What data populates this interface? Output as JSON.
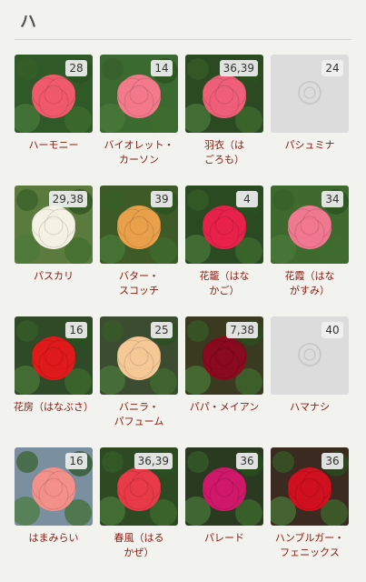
{
  "section": {
    "title": "ハ"
  },
  "items": [
    {
      "name": "ハーモニー",
      "badge": "28",
      "bg": "#2f5a28",
      "rose": "#f05a6a",
      "placeholder": false
    },
    {
      "name": "バイオレット・\nカーソン",
      "badge": "14",
      "bg": "#3b6a30",
      "rose": "#f37a8a",
      "placeholder": false
    },
    {
      "name": "羽衣（は\nごろも）",
      "badge": "36,39",
      "bg": "#2c4a22",
      "rose": "#ef5f78",
      "placeholder": false
    },
    {
      "name": "パシュミナ",
      "badge": "24",
      "bg": "#dcdcdc",
      "rose": "#c9c9c9",
      "placeholder": true
    },
    {
      "name": "パスカリ",
      "badge": "29,38",
      "bg": "#5b7a3e",
      "rose": "#f5f1e4",
      "placeholder": false
    },
    {
      "name": "バター・\nスコッチ",
      "badge": "39",
      "bg": "#3e5a26",
      "rose": "#e8a04a",
      "placeholder": false
    },
    {
      "name": "花籠（はな\nかご）",
      "badge": "4",
      "bg": "#2a4a22",
      "rose": "#e8214a",
      "placeholder": false
    },
    {
      "name": "花霞（はな\nがすみ）",
      "badge": "34",
      "bg": "#3f6a2f",
      "rose": "#f07890",
      "placeholder": false
    },
    {
      "name": "花房（はなぶさ）",
      "badge": "16",
      "bg": "#2f4a26",
      "rose": "#e01a1a",
      "placeholder": false
    },
    {
      "name": "バニラ・\nパフューム",
      "badge": "25",
      "bg": "#3c4c30",
      "rose": "#f5c896",
      "placeholder": false
    },
    {
      "name": "パパ・メイアン",
      "badge": "7,38",
      "bg": "#3a3a20",
      "rose": "#8a0a1e",
      "placeholder": false
    },
    {
      "name": "ハマナシ",
      "badge": "40",
      "bg": "#dcdcdc",
      "rose": "#c9c9c9",
      "placeholder": true
    },
    {
      "name": "はまみらい",
      "badge": "16",
      "bg": "#7a90a0",
      "rose": "#f4908a",
      "placeholder": false
    },
    {
      "name": "春風（はる\nかぜ）",
      "badge": "36,39",
      "bg": "#2e4a22",
      "rose": "#e83a48",
      "placeholder": false
    },
    {
      "name": "パレード",
      "badge": "36",
      "bg": "#2a3a20",
      "rose": "#d0186a",
      "placeholder": false
    },
    {
      "name": "ハンブルガー・\nフェニックス",
      "badge": "36",
      "bg": "#3a2a20",
      "rose": "#d0101e",
      "placeholder": false
    }
  ]
}
